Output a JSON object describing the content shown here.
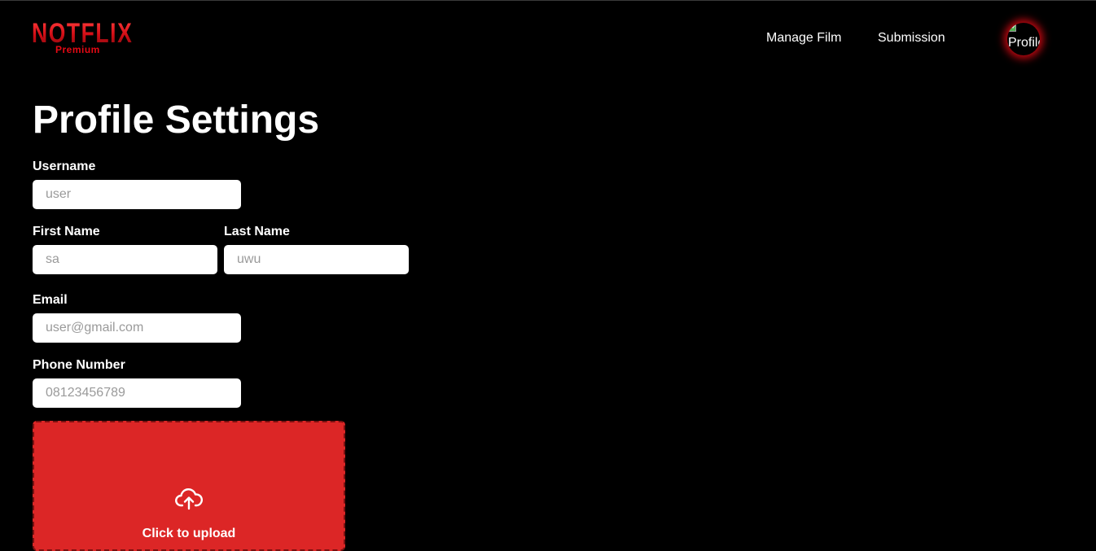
{
  "brand": {
    "name": "NOTFLIX",
    "tier": "Premium",
    "accent_color": "#e50914"
  },
  "nav": {
    "items": [
      {
        "label": "Manage Film"
      },
      {
        "label": "Submission"
      }
    ],
    "avatar_alt": "Profile"
  },
  "page": {
    "title": "Profile Settings"
  },
  "form": {
    "username": {
      "label": "Username",
      "placeholder": "user",
      "value": ""
    },
    "first_name": {
      "label": "First Name",
      "placeholder": "sa",
      "value": ""
    },
    "last_name": {
      "label": "Last Name",
      "placeholder": "uwu",
      "value": ""
    },
    "email": {
      "label": "Email",
      "placeholder": "user@gmail.com",
      "value": ""
    },
    "phone": {
      "label": "Phone Number",
      "placeholder": "08123456789",
      "value": ""
    },
    "upload": {
      "icon": "cloud-upload-icon",
      "text": "Click to upload",
      "color": "#dc2626"
    }
  }
}
